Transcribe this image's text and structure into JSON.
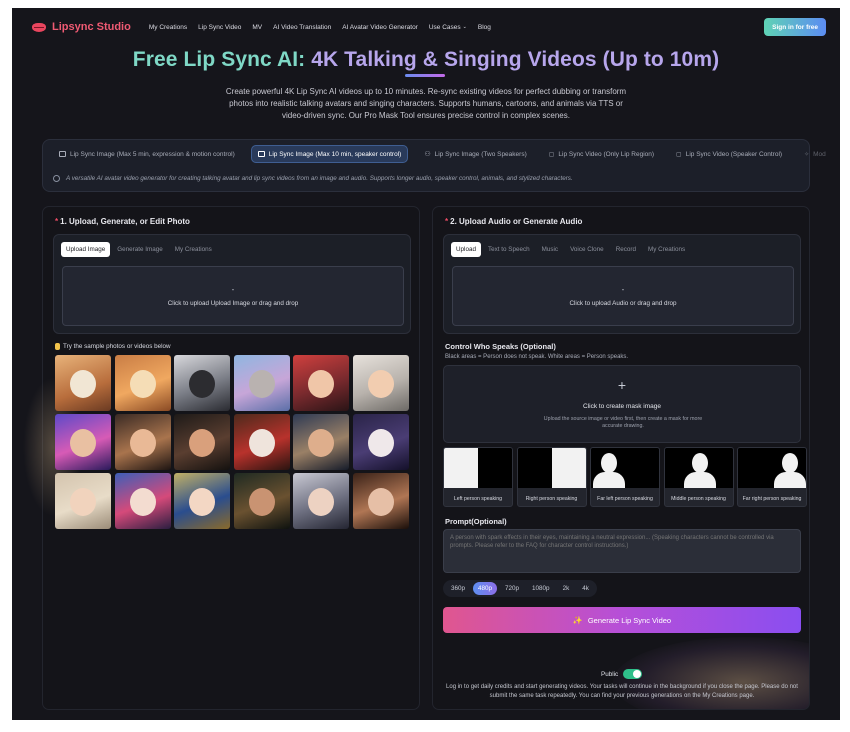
{
  "nav": {
    "brand": "Lipsync Studio",
    "links": [
      "My Creations",
      "Lip Sync Video",
      "MV",
      "AI Video Translation",
      "AI Avatar Video Generator",
      "Use Cases",
      "Blog"
    ],
    "signin": "Sign in for free"
  },
  "hero": {
    "title_a": "Free Lip Sync AI: ",
    "title_b": "4K Talking & Singing Videos (Up to 10m)",
    "desc": "Create powerful 4K Lip Sync AI videos up to 10 minutes. Re-sync existing videos for perfect dubbing or transform photos into realistic talking avatars and singing characters. Supports humans, cartoons, and animals via TTS or video-driven sync. Our Pro Mask Tool ensures precise control in complex scenes."
  },
  "modes": {
    "items": [
      "Lip Sync Image (Max 5 min, expression & motion control)",
      "Lip Sync Image (Max 10 min, speaker control)",
      "Lip Sync Image (Two Speakers)",
      "Lip Sync Video (Only Lip Region)",
      "Lip Sync Video (Speaker Control)",
      "Mod"
    ],
    "active_index": 1,
    "description": "A versatile AI avatar video generator for creating talking avatar and lip sync videos from an image and audio. Supports longer audio, speaker control, animals, and stylized characters."
  },
  "left": {
    "title": "1. Upload, Generate, or Edit Photo",
    "tabs": [
      "Upload Image",
      "Generate Image",
      "My Creations"
    ],
    "upload_icon": "-",
    "dropzone": "Click to upload Upload Image or drag and drop",
    "samples_label": "Try the sample photos or videos below"
  },
  "right": {
    "title": "2. Upload Audio or Generate Audio",
    "tabs": [
      "Upload",
      "Text to Speech",
      "Music",
      "Voice Clone",
      "Record",
      "My Creations"
    ],
    "upload_icon": "-",
    "dropzone": "Click to upload Audio or drag and drop",
    "cws_title": "Control Who Speaks (Optional)",
    "cws_desc": "Black areas = Person does not speak. White areas = Person speaks.",
    "mask_plus": "+",
    "mask_title": "Click to create mask image",
    "mask_desc": "Upload the source image or video first, then create a mask for more accurate drawing.",
    "speakers": [
      "Left person speaking",
      "Right person speaking",
      "Far left person speaking",
      "Middle person speaking",
      "Far right person speaking"
    ],
    "prompt_title": "Prompt(Optional)",
    "prompt_placeholder": "A person with spark effects in their eyes, maintaining a neutral expression... (Speaking characters cannot be controlled via prompts. Please refer to the FAQ for character control instructions.)",
    "resolutions": [
      "360p",
      "480p",
      "720p",
      "1080p",
      "2k",
      "4k"
    ],
    "active_resolution": 1,
    "generate": "Generate Lip Sync Video",
    "public_label": "Public",
    "note": "Log in to get daily credits and start generating videos. Your tasks will continue in the background if you close the page. Please do not submit the same task repeatedly. You can find your previous generations on the My Creations page."
  }
}
